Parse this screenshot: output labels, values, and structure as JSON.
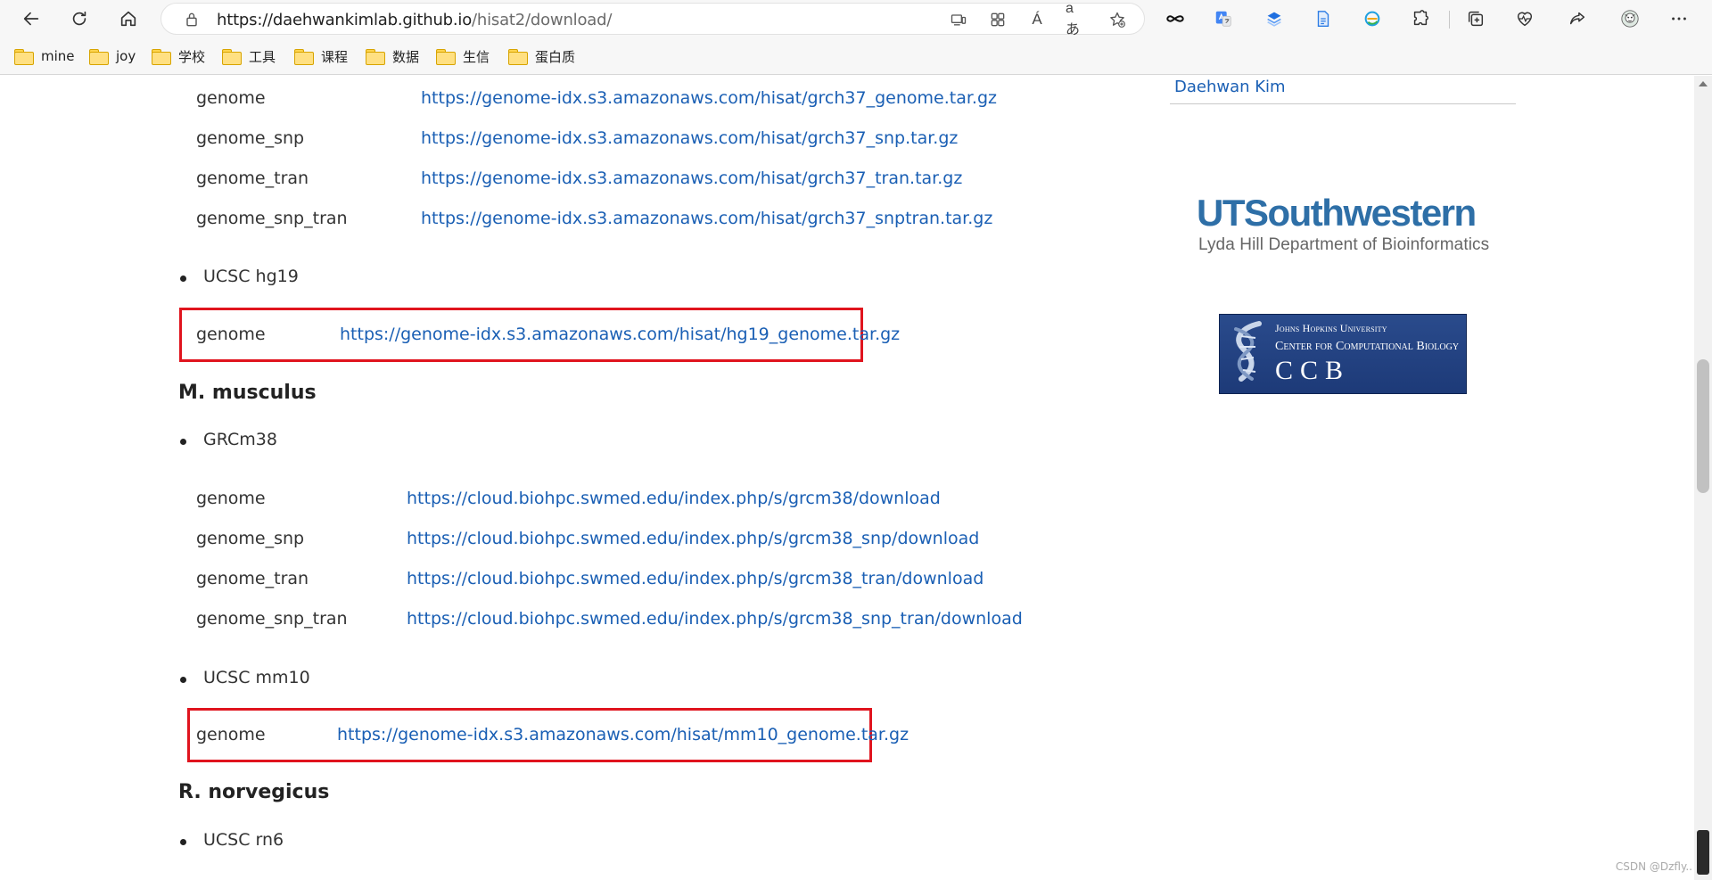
{
  "browser": {
    "url_host": "https://daehwankimlab.github.io",
    "url_path": "/hisat2/download/",
    "read_aloud_label": "Á",
    "translate_label": "aあ",
    "bookmarks": [
      "mine",
      "joy",
      "学校",
      "工具",
      "课程",
      "数据",
      "生信",
      "蛋白质"
    ]
  },
  "sidebar": {
    "author": "Daehwan Kim",
    "utsw_main": "UTSouthwestern",
    "utsw_sub": "Lyda Hill Department of Bioinformatics",
    "ccb_line1": "Johns Hopkins University",
    "ccb_line2": "Center for Computational Biology",
    "ccb_line3": "CCB"
  },
  "content": {
    "grch37_rows": [
      {
        "label": "genome",
        "link": "https://genome-idx.s3.amazonaws.com/hisat/grch37_genome.tar.gz"
      },
      {
        "label": "genome_snp",
        "link": "https://genome-idx.s3.amazonaws.com/hisat/grch37_snp.tar.gz"
      },
      {
        "label": "genome_tran",
        "link": "https://genome-idx.s3.amazonaws.com/hisat/grch37_tran.tar.gz"
      },
      {
        "label": "genome_snp_tran",
        "link": "https://genome-idx.s3.amazonaws.com/hisat/grch37_snptran.tar.gz"
      }
    ],
    "hg19_bullet": "UCSC hg19",
    "hg19_row": {
      "label": "genome",
      "link": "https://genome-idx.s3.amazonaws.com/hisat/hg19_genome.tar.gz"
    },
    "mmus_title": "M. musculus",
    "grcm38_bullet": "GRCm38",
    "grcm38_rows": [
      {
        "label": "genome",
        "link": "https://cloud.biohpc.swmed.edu/index.php/s/grcm38/download"
      },
      {
        "label": "genome_snp",
        "link": "https://cloud.biohpc.swmed.edu/index.php/s/grcm38_snp/download"
      },
      {
        "label": "genome_tran",
        "link": "https://cloud.biohpc.swmed.edu/index.php/s/grcm38_tran/download"
      },
      {
        "label": "genome_snp_tran",
        "link": "https://cloud.biohpc.swmed.edu/index.php/s/grcm38_snp_tran/download"
      }
    ],
    "mm10_bullet": "UCSC mm10",
    "mm10_row": {
      "label": "genome",
      "link": "https://genome-idx.s3.amazonaws.com/hisat/mm10_genome.tar.gz"
    },
    "rnor_title": "R. norvegicus",
    "rn6_bullet": "UCSC rn6"
  },
  "watermark": "CSDN @Dzfly..",
  "colors": {
    "link": "#1a5fb4",
    "highlight": "#e0141e",
    "utsw_blue": "#2e6fa7"
  }
}
